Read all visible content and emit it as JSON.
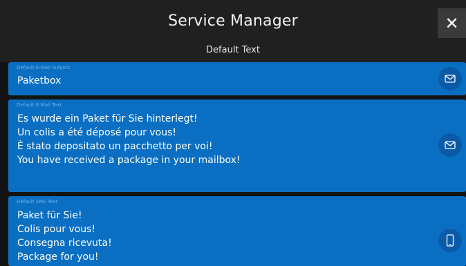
{
  "colors": {
    "background": "#141414",
    "header": "#202020",
    "card": "#0a6fc2",
    "action_button": "#0b5aa8",
    "label": "#6fb0e8"
  },
  "header": {
    "title": "Service Manager",
    "subtitle": "Default Text",
    "close_icon": "close-icon",
    "close_label": "✕"
  },
  "fields": [
    {
      "label": "Default E-Mail Subject",
      "value": "Paketbox",
      "icon": "envelope-icon"
    },
    {
      "label": "Default E-Mail Text",
      "value": "Es wurde ein Paket für Sie hinterlegt!\nUn colis a été déposé pour vous!\nÈ stato depositato un pacchetto per voi!\nYou have received a package in your mailbox!",
      "icon": "envelope-icon"
    },
    {
      "label": "Default SMS Text",
      "value": "Paket für Sie!\nColis pour vous!\nConsegna ricevuta!\nPackage for you!",
      "icon": "phone-icon"
    }
  ]
}
